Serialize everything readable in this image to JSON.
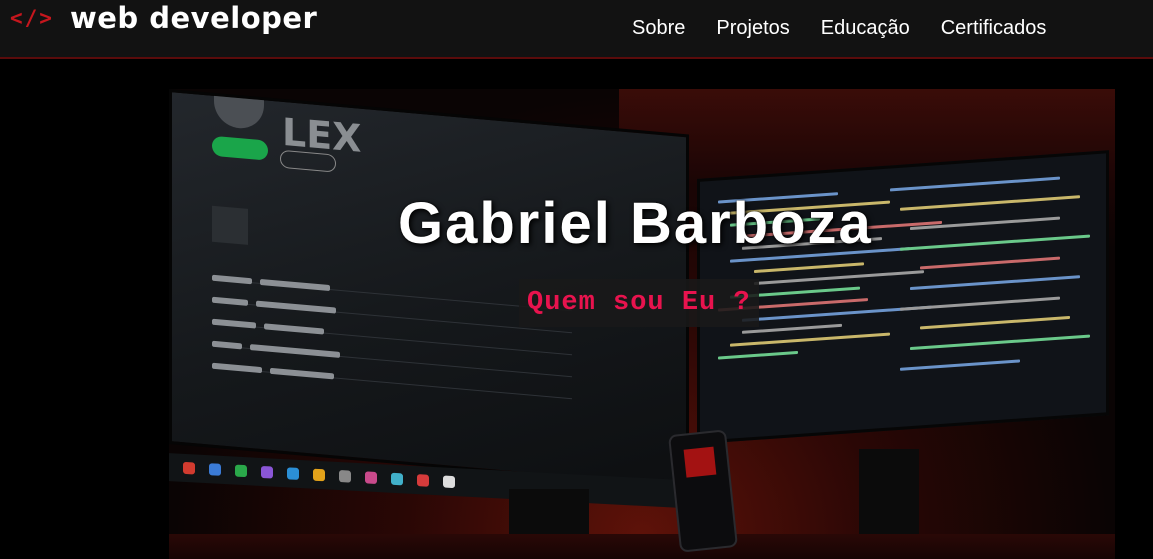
{
  "header": {
    "logo_code": "</>",
    "logo_text": "web developer",
    "nav": [
      {
        "label": "Sobre"
      },
      {
        "label": "Projetos"
      },
      {
        "label": "Educação"
      },
      {
        "label": "Certificados"
      }
    ]
  },
  "hero": {
    "title": "Gabriel Barboza",
    "subtitle": "Quem sou Eu ?",
    "screen_text": "LEX"
  },
  "colors": {
    "accent": "#e8134e",
    "logo_code": "#c5161d",
    "header_bg": "#121212"
  }
}
